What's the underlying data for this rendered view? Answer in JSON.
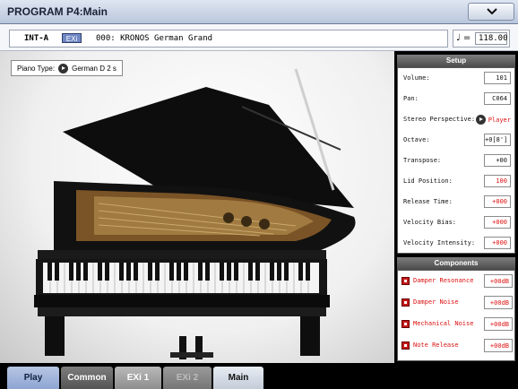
{
  "titlebar": {
    "title": "PROGRAM P4:Main"
  },
  "program": {
    "bank": "INT-A",
    "engine_tag": "EXi",
    "name": "000: KRONOS German Grand",
    "tempo_symbol": "♩ =",
    "tempo": "118.00"
  },
  "piano_type": {
    "label": "Piano Type:",
    "value": "German D 2 s"
  },
  "setup": {
    "header": "Setup",
    "volume": {
      "label": "Volume:",
      "value": "101"
    },
    "pan": {
      "label": "Pan:",
      "value": "C064"
    },
    "stereo": {
      "label": "Stereo Perspective:",
      "value": "Player"
    },
    "octave": {
      "label": "Octave:",
      "value": "+0[8']"
    },
    "transpose": {
      "label": "Transpose:",
      "value": "+00"
    },
    "lid": {
      "label": "Lid Position:",
      "value": "100"
    },
    "release": {
      "label": "Release Time:",
      "value": "+000"
    },
    "vel_bias": {
      "label": "Velocity Bias:",
      "value": "+000"
    },
    "vel_int": {
      "label": "Velocity Intensity:",
      "value": "+000"
    }
  },
  "components": {
    "header": "Components",
    "items": [
      {
        "label": "Damper Resonance",
        "value": "+00dB"
      },
      {
        "label": "Damper Noise",
        "value": "+00dB"
      },
      {
        "label": "Mechanical Noise",
        "value": "+00dB"
      },
      {
        "label": "Note Release",
        "value": "+00dB"
      }
    ]
  },
  "tabs": {
    "play": "Play",
    "common": "Common",
    "exi1": "EXi 1",
    "exi2": "EXi 2",
    "main": "Main"
  },
  "colors": {
    "accent_red": "#d11111",
    "tab_selected": "#8ea5d2",
    "tag_blue": "#6f87c4"
  },
  "icons": {
    "menu": "chevron-down-icon",
    "piano_type_select": "circle-arrow-icon",
    "stereo_select": "circle-arrow-icon",
    "checkbox": "checkbox-icon"
  }
}
